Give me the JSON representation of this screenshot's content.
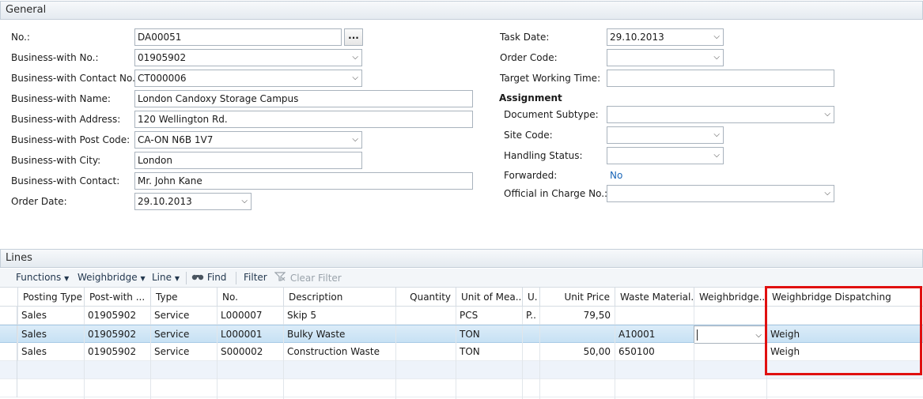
{
  "general": {
    "title": "General",
    "left_fields": [
      {
        "label": "No.:",
        "value": "DA00051"
      },
      {
        "label": "Business-with No.:",
        "value": "01905902"
      },
      {
        "label": "Business-with Contact No.:",
        "value": "CT000006"
      },
      {
        "label": "Business-with Name:",
        "value": "London Candoxy Storage Campus"
      },
      {
        "label": "Business-with Address:",
        "value": "120 Wellington Rd."
      },
      {
        "label": "Business-with Post Code:",
        "value": "CA-ON N6B 1V7"
      },
      {
        "label": "Business-with City:",
        "value": "London"
      },
      {
        "label": "Business-with Contact:",
        "value": "Mr. John Kane"
      },
      {
        "label": "Order Date:",
        "value": "29.10.2013"
      }
    ],
    "assist_button": "...",
    "right_fields": [
      {
        "label": "Task Date:",
        "value": "29.10.2013"
      },
      {
        "label": "Order Code:",
        "value": ""
      },
      {
        "label": "Target Working Time:",
        "value": ""
      }
    ],
    "assignment": {
      "heading": "Assignment",
      "fields": [
        {
          "label": "Document Subtype:",
          "value": ""
        },
        {
          "label": "Site Code:",
          "value": ""
        },
        {
          "label": "Handling Status:",
          "value": ""
        },
        {
          "label": "Forwarded:",
          "value": "No"
        },
        {
          "label": "Official in Charge No.:",
          "value": ""
        }
      ]
    }
  },
  "lines": {
    "title": "Lines",
    "toolbar": {
      "functions": "Functions",
      "weighbridge": "Weighbridge",
      "line": "Line",
      "find": "Find",
      "filter": "Filter",
      "clear_filter": "Clear Filter"
    },
    "columns": [
      "Posting Type",
      "Post-with ...",
      "Type",
      "No.",
      "Description",
      "Quantity",
      "Unit of Mea...",
      "U.",
      "Unit Price",
      "Waste Material...",
      "Weighbridge...",
      "Weighbridge Dispatching"
    ],
    "rows": [
      [
        "Sales",
        "01905902",
        "Service",
        "L000007",
        "Skip 5",
        "",
        "PCS",
        "P..",
        "79,50",
        "",
        "",
        ""
      ],
      [
        "Sales",
        "01905902",
        "Service",
        "L000001",
        "Bulky Waste",
        "",
        "TON",
        "",
        "",
        "A10001",
        "",
        "Weigh"
      ],
      [
        "Sales",
        "01905902",
        "Service",
        "S000002",
        "Construction Waste",
        "",
        "TON",
        "",
        "50,00",
        "650100",
        "",
        "Weigh"
      ]
    ]
  },
  "colors": {
    "highlight": "#e01010",
    "link": "#1a66b8",
    "selected_row": "#c7e1f4"
  }
}
